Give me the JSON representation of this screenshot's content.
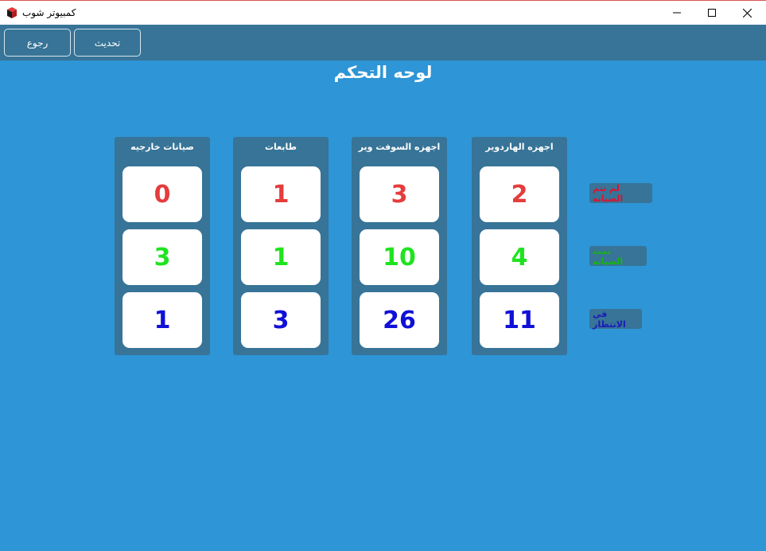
{
  "window": {
    "title": "كمبيوتر شوب"
  },
  "toolbar": {
    "back_label": "رجوع",
    "refresh_label": "تحديث"
  },
  "page": {
    "title": "لوحه التحكم"
  },
  "colors": {
    "background": "#2e95d6",
    "panel": "#377497",
    "not_serviced": "#e53c3c",
    "serviced": "#1fe31f",
    "waiting": "#1010d8",
    "legend_not_serviced_text": "#e0102e",
    "legend_serviced_text": "#17b515",
    "legend_waiting_text": "#1b1bb8"
  },
  "legend": {
    "not_serviced": "لم تتم الصيانه",
    "serviced": "تمت الصيانه",
    "waiting": "في الانتظار"
  },
  "panels": [
    {
      "title": "اجهزه الهاردوير",
      "not_serviced": "2",
      "serviced": "4",
      "waiting": "11"
    },
    {
      "title": "اجهزه السوفت وير",
      "not_serviced": "3",
      "serviced": "10",
      "waiting": "26"
    },
    {
      "title": "طابعات",
      "not_serviced": "1",
      "serviced": "1",
      "waiting": "3"
    },
    {
      "title": "صيانات خارجيه",
      "not_serviced": "0",
      "serviced": "3",
      "waiting": "1"
    }
  ]
}
